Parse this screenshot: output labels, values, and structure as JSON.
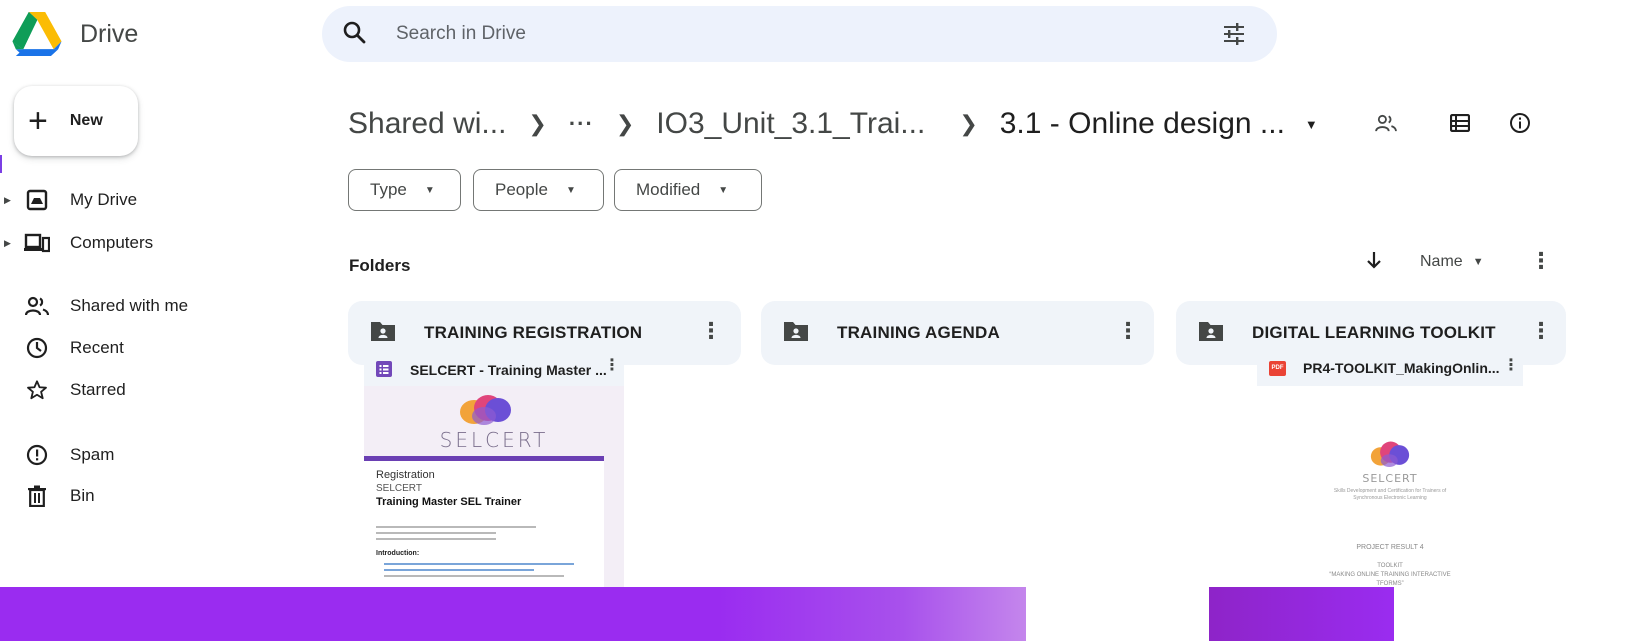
{
  "app": {
    "name": "Drive"
  },
  "new_button": {
    "label": "New"
  },
  "search": {
    "placeholder": "Search in Drive"
  },
  "nav": [
    {
      "label": "My Drive",
      "icon": "my-drive-icon",
      "caret": true
    },
    {
      "label": "Computers",
      "icon": "computers-icon",
      "caret": true
    },
    {
      "label": "Shared with me",
      "icon": "people-icon",
      "caret": false
    },
    {
      "label": "Recent",
      "icon": "clock-icon",
      "caret": false
    },
    {
      "label": "Starred",
      "icon": "star-icon",
      "caret": false
    },
    {
      "label": "Spam",
      "icon": "spam-icon",
      "caret": false
    },
    {
      "label": "Bin",
      "icon": "bin-icon",
      "caret": false
    }
  ],
  "breadcrumb": {
    "items": [
      "Shared wi...",
      "IO3_Unit_3.1_Trai..."
    ],
    "ellipsis": "···",
    "current": "3.1 - Online design ..."
  },
  "filters": [
    "Type",
    "People",
    "Modified"
  ],
  "folders_section": {
    "title": "Folders",
    "sort_label": "Name",
    "items": [
      {
        "name": "TRAINING REGISTRATION"
      },
      {
        "name": "TRAINING AGENDA"
      },
      {
        "name": "DIGITAL LEARNING TOOLKIT"
      }
    ]
  },
  "files": [
    {
      "name": "SELCERT - Training Master ...",
      "type": "forms",
      "preview": {
        "brand": "SELCERT",
        "line1": "Registration",
        "line2": "SELCERT",
        "title": "Training Master SEL Trainer",
        "section": "Introduction:"
      }
    },
    {
      "name": "PR4-TOOLKIT_MakingOnlin...",
      "type": "pdf",
      "badge": "PDF",
      "preview": {
        "brand": "SELCERT",
        "tagline": "Skills Development and Certification for Trainers of Synchronous Electronic Learning",
        "project": "PROJECT RESULT 4",
        "doc_type": "TOOLKIT",
        "doc_title": "“MAKING ONLINE TRAINING INTERACTIVE",
        "doc_title2": "TFORMS”"
      }
    }
  ],
  "colors": {
    "accent_purple": "#9a2cf0",
    "drive_blue": "#1a73e8",
    "drive_green": "#0f9d58",
    "drive_yellow": "#fbbc04",
    "surface": "#f0f4f9"
  }
}
